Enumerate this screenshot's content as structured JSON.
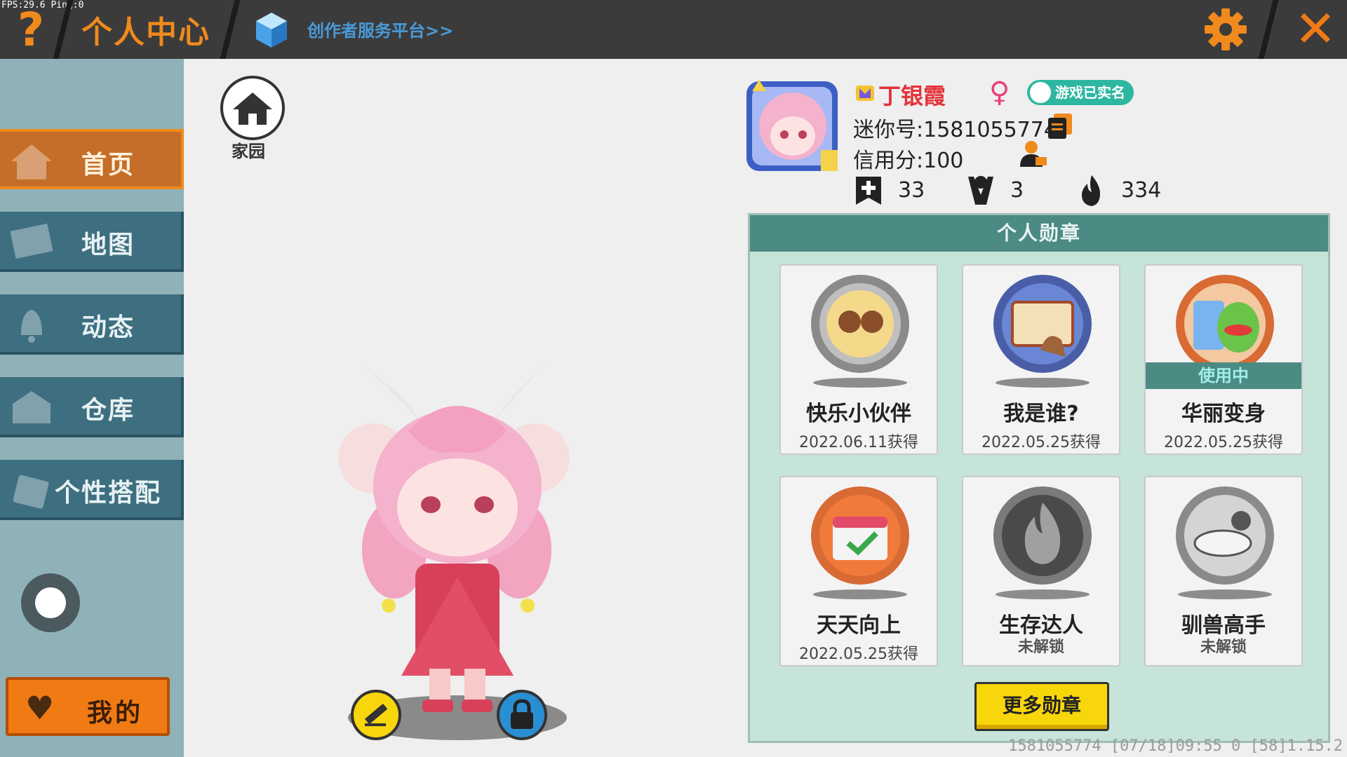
{
  "debug": {
    "fps_text": "FPS:29.6  Ping:0"
  },
  "topbar": {
    "help_label": "?",
    "title": "个人中心",
    "creator_link": "创作者服务平台>>",
    "close_label": "✕"
  },
  "sidebar": {
    "items": [
      {
        "label": "首页",
        "active": true
      },
      {
        "label": "地图",
        "active": false
      },
      {
        "label": "动态",
        "active": false
      },
      {
        "label": "仓库",
        "active": false
      },
      {
        "label": "个性搭配",
        "active": false
      }
    ],
    "mine_label": "我的"
  },
  "home": {
    "label": "家园"
  },
  "profile": {
    "nickname": "丁银霞",
    "gender_symbol": "♀",
    "verified_label": "游戏已实名",
    "mini_id": "迷你号:1581055774",
    "credit": "信用分:100",
    "stats": {
      "plus": "33",
      "likes": "3",
      "popularity": "334"
    }
  },
  "badges": {
    "header": "个人勋章",
    "items": [
      {
        "name": "快乐小伙伴",
        "date": "2022.06.11获得",
        "in_use": false
      },
      {
        "name": "我是谁?",
        "date": "2022.05.25获得",
        "in_use": false
      },
      {
        "name": "华丽变身",
        "date": "2022.05.25获得",
        "in_use": true,
        "in_use_label": "使用中"
      },
      {
        "name": "天天向上",
        "date": "2022.05.25获得",
        "in_use": false
      },
      {
        "name": "生存达人",
        "date": "未解锁",
        "in_use": false
      },
      {
        "name": "驯兽高手",
        "date": "未解锁",
        "in_use": false
      }
    ],
    "more_label": "更多勋章"
  },
  "footer": {
    "info": "1581055774   [07/18]09:55 0   [58]1.15.2"
  },
  "colors": {
    "accent_orange": "#f08a1c",
    "nav_teal": "#3d6f80",
    "panel_green": "#c6e4d8",
    "button_yellow": "#f8d60c"
  }
}
